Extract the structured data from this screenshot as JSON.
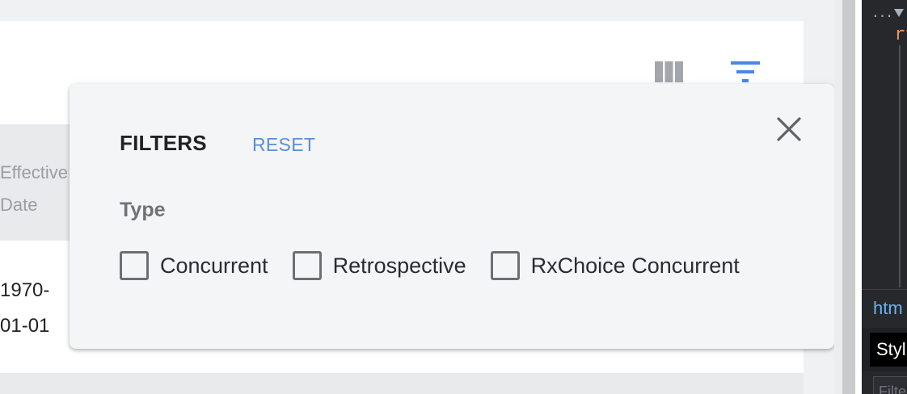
{
  "table": {
    "header_effective": "Effective",
    "header_date": "Date",
    "row1_line1": "1970-",
    "row1_line2": "01-01"
  },
  "filters": {
    "title": "FILTERS",
    "reset_label": "RESET",
    "section_type": "Type",
    "options": [
      {
        "label": "Concurrent",
        "checked": false
      },
      {
        "label": "Retrospective",
        "checked": false
      },
      {
        "label": "RxChoice Concurrent",
        "checked": false
      }
    ]
  },
  "icons": {
    "columns": "view-columns-icon",
    "filter": "filter-list-icon",
    "close": "close-icon"
  },
  "colors": {
    "accent": "#5b8ed6",
    "filter_icon": "#4a86e8",
    "columns_icon": "#a3a6aa"
  },
  "devtools": {
    "dots": "...",
    "code_text": "rf",
    "breadcrumb": "htm",
    "tab_label": "Styl",
    "filter_placeholder": "Filte"
  }
}
